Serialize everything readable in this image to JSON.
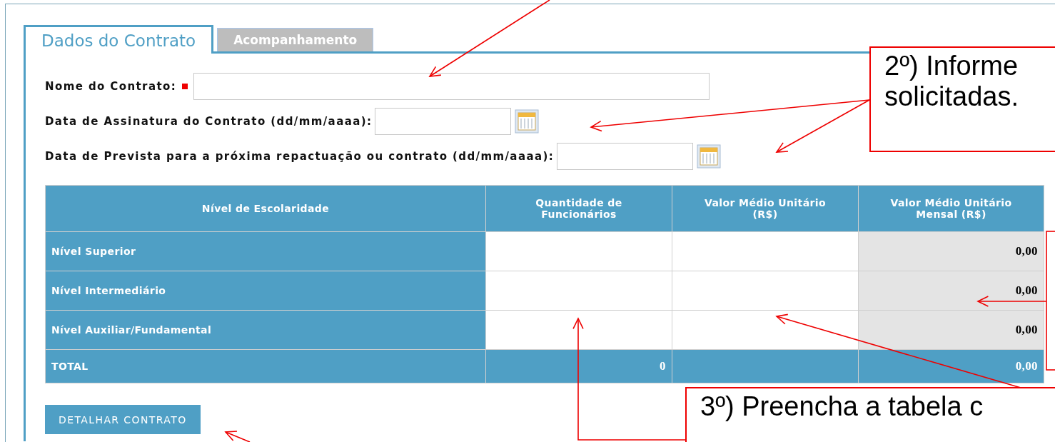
{
  "tabs": [
    {
      "label": "Dados do Contrato",
      "selected": true
    },
    {
      "label": "Acompanhamento",
      "selected": false
    }
  ],
  "form": {
    "fields": [
      {
        "label": "Nome do Contrato:",
        "required": true,
        "kind": "text"
      },
      {
        "label": "Data de Assinatura do Contrato (dd/mm/aaaa):",
        "required": false,
        "kind": "date"
      },
      {
        "label": "Data de Prevista para a próxima repactuação ou contrato (dd/mm/aaaa):",
        "required": false,
        "kind": "date"
      }
    ]
  },
  "table": {
    "columns": [
      "Nível de Escolaridade",
      "Quantidade de Funcionários",
      "Valor Médio Unitário (R$)",
      "Valor Médio Unitário Mensal (R$)"
    ],
    "rows": [
      {
        "label": "Nível Superior",
        "monthly": "0,00"
      },
      {
        "label": "Nível Intermediário",
        "monthly": "0,00"
      },
      {
        "label": "Nível Auxiliar/Fundamental",
        "monthly": "0,00"
      }
    ],
    "total": {
      "label": "TOTAL",
      "quantity": "0",
      "monthly": "0,00"
    }
  },
  "button": "DETALHAR CONTRATO",
  "callouts": [
    {
      "lines": [
        "2º) Informe",
        "solicitadas."
      ]
    },
    {
      "lines": [
        "3º) Preencha a tabela c"
      ]
    }
  ]
}
